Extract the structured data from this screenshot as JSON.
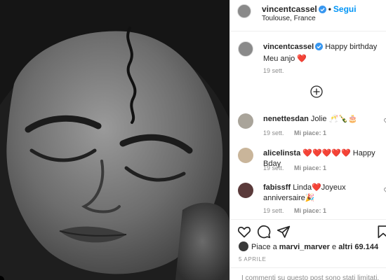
{
  "post": {
    "author": "vincentcassel",
    "separator": "•",
    "follow_label": "Segui",
    "location": "Toulouse, France"
  },
  "caption": {
    "user": "vincentcassel",
    "text": "Happy birthday Meu anjo",
    "emoji": "❤️",
    "time": "19 sett."
  },
  "comments": [
    {
      "user": "nenettesdan",
      "text": "Jolie 🥂🍾🎂",
      "time": "19 sett.",
      "likes": "Mi piace: 1"
    },
    {
      "user": "alicelinsta",
      "text": "❤️❤️❤️❤️❤️ Happy Bday",
      "time": "19 sett.",
      "likes": "Mi piace: 1"
    },
    {
      "user": "fabissff",
      "text": "Linda❤️Joyeux anniversaire🎉",
      "time": "19 sett.",
      "likes": "Mi piace: 1"
    }
  ],
  "likes": {
    "prefix": "Piace a",
    "user": "marvi_marver",
    "middle": "e",
    "others": "altri 69.144"
  },
  "date": "5 APRILE",
  "footer_text": "I commenti su questo post sono stati limitati.",
  "icons": {
    "verified": "verified-badge-icon",
    "load_more": "plus-circle-icon",
    "like": "heart-outline-icon",
    "comment": "comment-icon",
    "share": "paper-plane-icon",
    "save": "bookmark-icon"
  },
  "colors": {
    "accent": "#0095f6",
    "heart": "#ed1c24",
    "secondary_text": "#8e8e8e",
    "border": "#efefef"
  }
}
